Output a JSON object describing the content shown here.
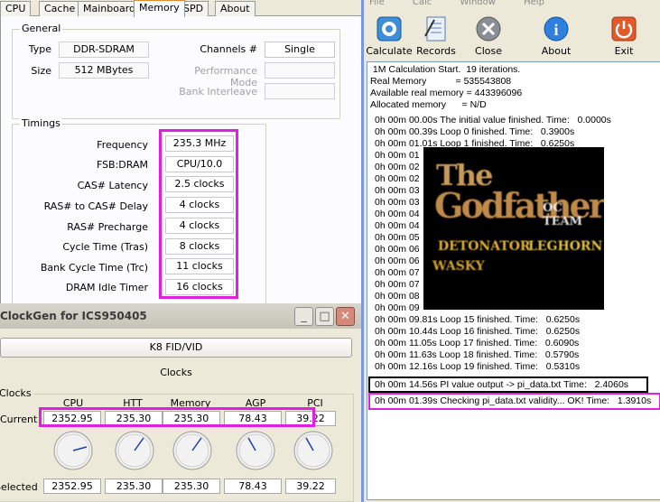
{
  "cpuz": {
    "tabs": [
      "CPU",
      "Cache",
      "Mainboard",
      "Memory",
      "SPD",
      "About"
    ],
    "active_tab": "Memory",
    "general": {
      "title": "General",
      "type_label": "Type",
      "type_value": "DDR-SDRAM",
      "channels_label": "Channels #",
      "channels_value": "Single",
      "size_label": "Size",
      "size_value": "512 MBytes",
      "perf_mode_label": "Performance Mode",
      "bank_interleave_label": "Bank Interleave"
    },
    "timings": {
      "title": "Timings",
      "rows": [
        {
          "label": "Frequency",
          "value": "235.3 MHz"
        },
        {
          "label": "FSB:DRAM",
          "value": "CPU/10.0"
        },
        {
          "label": "CAS# Latency",
          "value": "2.5 clocks"
        },
        {
          "label": "RAS# to CAS# Delay",
          "value": "4 clocks"
        },
        {
          "label": "RAS# Precharge",
          "value": "4 clocks"
        },
        {
          "label": "Cycle Time (Tras)",
          "value": "8 clocks"
        },
        {
          "label": "Bank Cycle Time (Trc)",
          "value": "11 clocks"
        },
        {
          "label": "DRAM Idle Timer",
          "value": "16 clocks"
        }
      ]
    },
    "highlight_color": "#e020e0"
  },
  "superpi": {
    "menu": [
      "File",
      "Calc",
      "Window",
      "Help"
    ],
    "toolbar": [
      {
        "label": "Calculate",
        "icon": "calculate-icon"
      },
      {
        "label": "Records",
        "icon": "records-icon"
      },
      {
        "label": "Close",
        "icon": "close-icon"
      },
      {
        "label": "About",
        "icon": "info-icon"
      },
      {
        "label": "Exit",
        "icon": "power-icon"
      }
    ],
    "console_header": [
      " 1M Calculation Start.  19 iterations.",
      "Real Memory           = 535543808",
      "Available real memory = 443396096",
      "Allocated memory      = N/D"
    ],
    "console_loops": [
      "0h 00m 00.00s The initial value finished. Time:   0.0000s",
      "0h 00m 00.39s Loop 0 finished. Time:   0.3900s",
      "0h 00m 01.01s Loop 1 finished. Time:   0.6250s",
      "0h 00m 01",
      "0h 00m 02",
      "0h 00m 02",
      "0h 00m 03",
      "0h 00m 03",
      "0h 00m 04",
      "0h 00m 04",
      "0h 00m 05",
      "0h 00m 06",
      "0h 00m 06",
      "0h 00m 07",
      "0h 00m 07",
      "0h 00m 08",
      "0h 00m 09",
      "0h 00m 09.81s Loop 15 finished. Time:   0.6250s",
      "0h 00m 10.44s Loop 16 finished. Time:   0.6250s",
      "0h 00m 11.05s Loop 17 finished. Time:   0.6090s",
      "0h 00m 11.63s Loop 18 finished. Time:   0.5790s",
      "0h 00m 12.16s Loop 19 finished. Time:   0.5310s"
    ],
    "pi_output_line": "0h 00m 14.56s PI value output -> pi_data.txt Time:   2.4060s",
    "check_line": "0h 00m 01.39s Checking pi_data.txt validity... OK! Time:   1.3910s",
    "banner": {
      "line1": "The",
      "line2": "Godfather",
      "line3": "OC TEAM",
      "line4": "DETONATOR",
      "line5": "LEGHORN",
      "line6": "WASKY"
    }
  },
  "clockgen": {
    "title": "ClockGen for ICS950405",
    "k8_button": "K8 FID/VID",
    "clocks_button": "Clocks",
    "group_title": "Clocks",
    "columns": [
      "CPU",
      "HTT",
      "Memory",
      "AGP",
      "PCI"
    ],
    "current_label": "Current",
    "current_values": [
      "2352.95",
      "235.30",
      "235.30",
      "78.43",
      "39.22"
    ],
    "selected_label": "Selected",
    "selected_values": [
      "2352.95",
      "235.30",
      "235.30",
      "78.43",
      "39.22"
    ]
  }
}
